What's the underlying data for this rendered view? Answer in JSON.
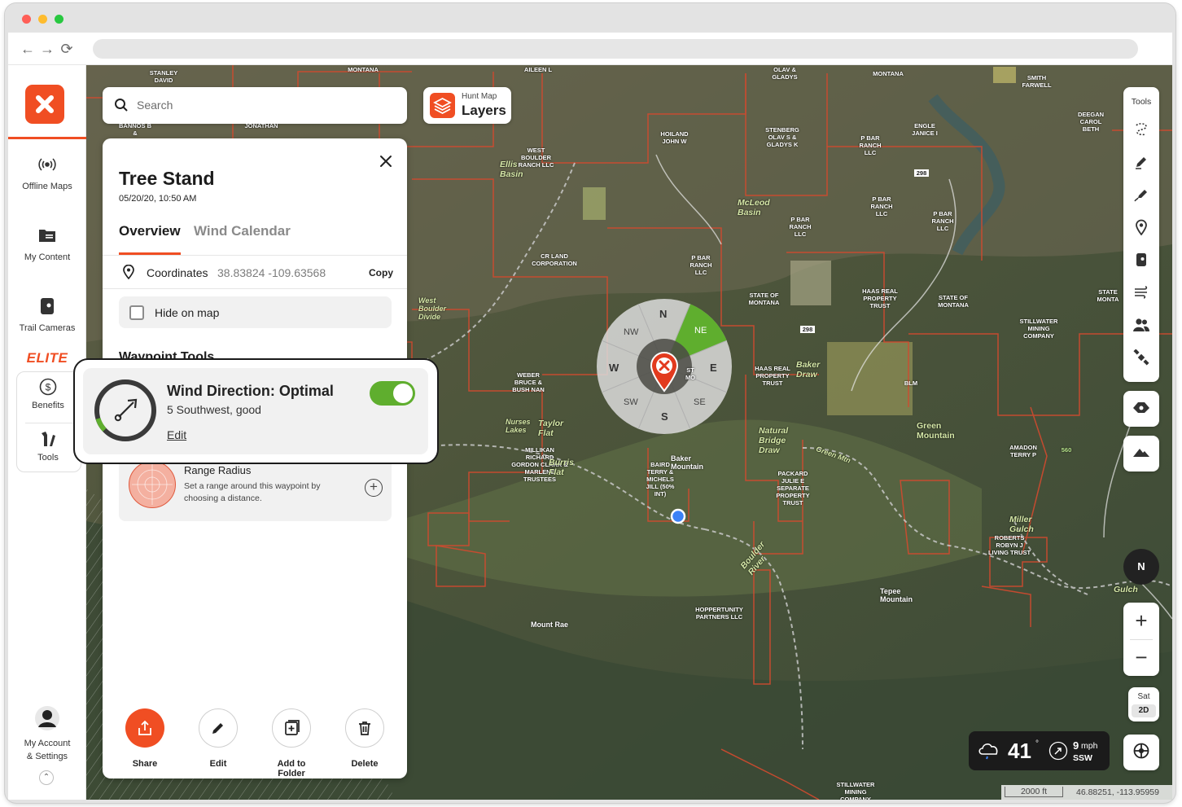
{
  "browser": {
    "dots": [
      "#ff5f57",
      "#febc2e",
      "#28c840"
    ],
    "nav": {
      "back": "←",
      "forward": "→",
      "reload": "⟳"
    }
  },
  "rail": {
    "items": [
      {
        "label": "Offline Maps"
      },
      {
        "label": "My Content"
      },
      {
        "label": "Trail Cameras"
      }
    ],
    "elite_label": "ELITE",
    "elite_items": [
      {
        "label": "Benefits"
      },
      {
        "label": "Tools"
      }
    ],
    "account": {
      "line1": "My Account",
      "line2": "& Settings"
    }
  },
  "search": {
    "placeholder": "Search"
  },
  "layers": {
    "small": "Hunt Map",
    "big": "Layers"
  },
  "panel": {
    "title": "Tree Stand",
    "date": "05/20/20, 10:50 AM",
    "tabs": [
      {
        "label": "Overview",
        "active": true
      },
      {
        "label": "Wind Calendar",
        "active": false
      }
    ],
    "coordinates": {
      "label": "Coordinates",
      "value": "38.83824  -109.63568",
      "copy": "Copy"
    },
    "hide_on_map": {
      "label": "Hide on map",
      "checked": false
    },
    "waypoint_tools_heading": "Waypoint Tools",
    "wind": {
      "title": "Wind Direction: Optimal",
      "subtitle": "5 Southwest, good",
      "edit": "Edit",
      "enabled": true
    },
    "range": {
      "title": "Range Radius",
      "desc": "Set a range around this waypoint by choosing a distance."
    },
    "actions": [
      {
        "label": "Share",
        "icon": "share-icon",
        "primary": true
      },
      {
        "label": "Edit",
        "icon": "pencil-icon",
        "primary": false
      },
      {
        "label": "Add to Folder",
        "icon": "add-folder-icon",
        "primary": false
      },
      {
        "label": "Delete",
        "icon": "trash-icon",
        "primary": false
      }
    ]
  },
  "wind_rose": {
    "directions": [
      "N",
      "NE",
      "E",
      "SE",
      "S",
      "SW",
      "W",
      "NW"
    ],
    "highlight": "NE",
    "highlight_color": "#5fae2e"
  },
  "tools": {
    "header": "Tools",
    "items": [
      "lasso-icon",
      "pen-icon",
      "marker-pen-icon",
      "pin-icon",
      "trail-camera-icon",
      "wind-icon",
      "people-icon",
      "satellite-icon"
    ]
  },
  "map_controls": {
    "compass": "N",
    "zoom_in": "+",
    "zoom_out": "−",
    "basemap": "Sat",
    "view_mode": "2D"
  },
  "weather": {
    "temperature": "41",
    "degree": "°",
    "wind_speed": "9",
    "wind_unit": "mph",
    "wind_dir": "SSW"
  },
  "scale": {
    "distance": "2000 ft",
    "coordinates": "46.88251, -113.95959"
  },
  "map_labels": [
    "STANLEY DAVID",
    "MONTANA",
    "AILEEN L",
    "OLAV & GLADYS",
    "MONTANA",
    "SMITH FARWELL",
    "BANNOS B &",
    "JONATHAN",
    "HOILAND JOHN W",
    "STENBERG OLAV S & GLADYS K",
    "P BAR RANCH LLC",
    "ENGLE JANICE I",
    "DEEGAN CAROL BETH",
    "WEST BOULDER RANCH LLC",
    "P BAR RANCH LLC",
    "P BAR RANCH LLC",
    "P BAR RANCH LLC",
    "P BAR RANCH LLC",
    "CR LAND CORPORATION",
    "STATE OF MONTANA",
    "HAAS REAL PROPERTY TRUST",
    "STATE OF MONTANA",
    "STILLWATER MINING COMPANY",
    "STATE MONTA",
    "WEBER BRUCE & BUSH NAN",
    "HAAS REAL PROPERTY TRUST",
    "BLM",
    "MILLIKAN RICHARD GORDON CLARK & MARLENE TRUSTEES",
    "BAIRD TERRY & MICHELS JILL (50% INT)",
    "PACKARD JULIE E SEPARATE PROPERTY TRUST",
    "AMADON TERRY P",
    "ROBERTS ROBYN J LIVING TRUST",
    "HOPPERTUNITY PARTNERS LLC",
    "STILLWATER MINING COMPANY",
    "ST MO"
  ],
  "map_names": [
    "Ellis Basin",
    "McLeod Basin",
    "West Boulder Divide",
    "Taylor Flat",
    "Nurses Lakes",
    "Burris Flat",
    "Baker Mountain",
    "Baker Draw",
    "Natural Bridge Draw",
    "Green Mountain",
    "Tepee Mountain",
    "Mount Rae",
    "Boulder River",
    "Green Mtn",
    "Miller Gulch",
    "Gulch"
  ],
  "map_numbers": [
    "298",
    "298",
    "560"
  ]
}
